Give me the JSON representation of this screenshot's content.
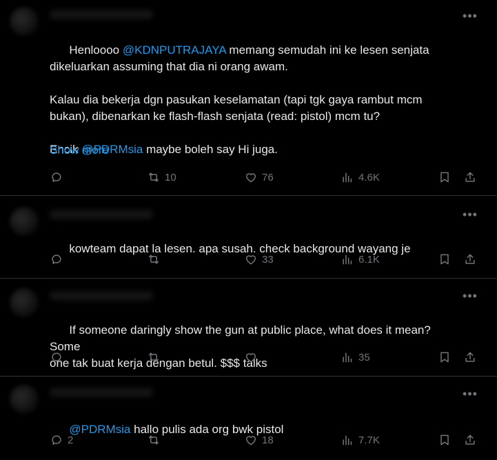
{
  "tweets": [
    {
      "segments": [
        {
          "text": "Henloooo ",
          "mention": false
        },
        {
          "text": "@KDNPUTRAJAYA",
          "mention": true
        },
        {
          "text": " memang semudah ini ke lesen senjata\ndikeluarkan assuming that dia ni orang awam.\n\nKalau dia bekerja dgn pasukan keselamatan (tapi tgk gaya rambut mcm\nbukan), dibenarkan ke flash-flash senjata (read: pistol) mcm tu?\n\nEncik ",
          "mention": false
        },
        {
          "text": "@PDRMsia",
          "mention": true
        },
        {
          "text": " maybe boleh say Hi juga.",
          "mention": false
        }
      ],
      "show_more": "Show more",
      "reply_count": "",
      "retweet_count": "10",
      "like_count": "76",
      "view_count": "4.6K"
    },
    {
      "segments": [
        {
          "text": "kowteam dapat la lesen. apa susah. check background wayang je",
          "mention": false
        }
      ],
      "reply_count": "",
      "retweet_count": "",
      "like_count": "33",
      "view_count": "6.1K"
    },
    {
      "segments": [
        {
          "text": "If someone daringly show the gun at public place, what does it mean? Some\none tak buat kerja dengan betul. $$$ talks",
          "mention": false
        }
      ],
      "reply_count": "",
      "retweet_count": "",
      "like_count": "",
      "view_count": "35"
    },
    {
      "segments": [
        {
          "text": "@PDRMsia",
          "mention": true
        },
        {
          "text": " hallo pulis ada org bwk pistol",
          "mention": false
        }
      ],
      "reply_count": "2",
      "retweet_count": "",
      "like_count": "18",
      "view_count": "7.7K"
    }
  ],
  "colors": {
    "background": "#000000",
    "text": "#e7e9ea",
    "muted": "#71767b",
    "link": "#1d9bf0",
    "divider": "#2f3336"
  },
  "icons": [
    "more-icon",
    "reply-icon",
    "retweet-icon",
    "like-icon",
    "views-icon",
    "bookmark-icon",
    "share-icon"
  ]
}
